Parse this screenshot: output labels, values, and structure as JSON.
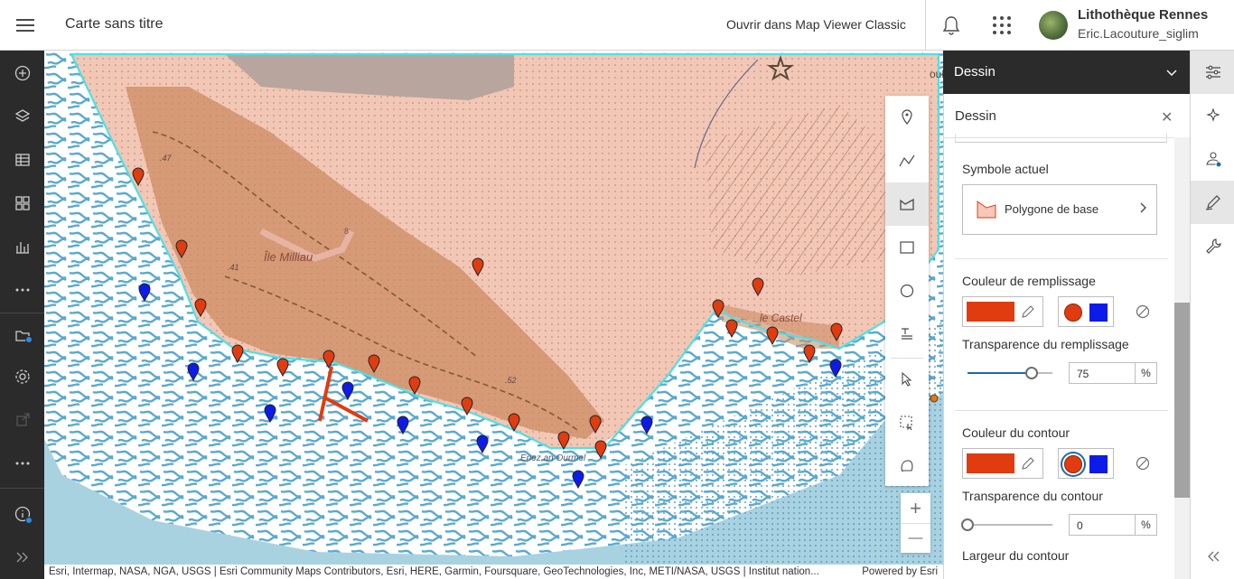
{
  "header": {
    "title": "Carte sans titre",
    "open_classic": "Ouvrir dans Map Viewer Classic",
    "user_org": "Lithothèque Rennes",
    "user_name": "Eric.Lacouture_siglim"
  },
  "left_rail": {
    "icons": [
      "add-icon",
      "layers-icon",
      "table-icon",
      "basemap-icon",
      "chart-icon",
      "more-icon",
      "map-properties-icon",
      "settings-icon",
      "share-icon",
      "more-icon",
      "info-icon",
      "expand-icon"
    ]
  },
  "map": {
    "labels": {
      "ile": "Île Milliau",
      "castel": "le Castel",
      "enez": "Enez an Ourmel",
      "elev1": ".47",
      "elev2": ".41",
      "elev3": ".52",
      "road": "8",
      "edge": "oul"
    },
    "attribution": "Esri, Intermap, NASA, NGA, USGS | Esri Community Maps Contributors, Esri, HERE, Garmin, Foursquare, GeoTechnologies, Inc, METI/NASA, USGS | Institut nation...",
    "powered": "Powered by Esri",
    "colors": {
      "sea": "#a9d2e1",
      "land": "#f5d3c4",
      "relief": "#c9926a",
      "outline": "#4fe0e6",
      "marker_red": "#e03c10",
      "marker_blue": "#0d1be8"
    }
  },
  "draw_tools": {
    "tools": [
      "point-tool",
      "polyline-tool",
      "polygon-tool",
      "rectangle-tool",
      "circle-tool",
      "text-tool",
      "select-tool",
      "select-rectangle-tool",
      "lasso-tool"
    ],
    "zoom_in": "+",
    "zoom_out": "—"
  },
  "panel": {
    "header": "Dessin",
    "title": "Dessin",
    "current_symbol_label": "Symbole actuel",
    "symbol_name": "Polygone de base",
    "fill_color_label": "Couleur de remplissage",
    "fill_transparency_label": "Transparence du remplissage",
    "fill_transparency_value": "75",
    "fill_transparency_level": 0.75,
    "outline_color_label": "Couleur du contour",
    "outline_transparency_label": "Transparence du contour",
    "outline_transparency_value": "0",
    "outline_transparency_level": 0,
    "outline_width_label": "Largeur du contour",
    "percent_unit": "%",
    "selected_color": "#e03c10",
    "quick_colors": [
      "#e03c10",
      "#0d1be8"
    ]
  },
  "right_rail": {
    "icons": [
      "properties-icon",
      "effects-icon",
      "styles-icon",
      "sketch-icon",
      "wrench-icon",
      "collapse-icon"
    ]
  }
}
